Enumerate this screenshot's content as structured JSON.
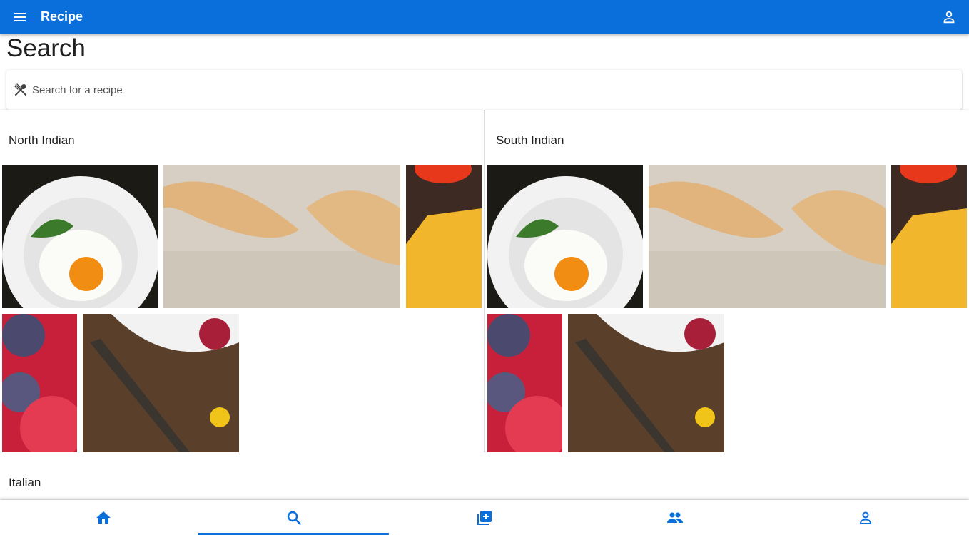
{
  "app": {
    "title": "Recipe",
    "accent_color": "#0a6fdb",
    "menu_icon": "menu-icon",
    "account_icon": "account-icon"
  },
  "page": {
    "title": "Search"
  },
  "search": {
    "placeholder": "Search for a recipe",
    "value": "",
    "icon": "utensils-icon"
  },
  "categories": [
    {
      "label": "North Indian",
      "images": [
        "fried-egg-plate",
        "dumplings-on-flour",
        "spaghetti-and-tomato",
        "raspberries-and-plums",
        "berry-bowl-with-spoon"
      ]
    },
    {
      "label": "South Indian",
      "images": [
        "fried-egg-plate",
        "dumplings-on-flour",
        "spaghetti-and-tomato",
        "raspberries-and-plums",
        "berry-bowl-with-spoon"
      ]
    },
    {
      "label": "Italian",
      "images": []
    }
  ],
  "bottom_nav": {
    "items": [
      {
        "name": "home",
        "icon": "home-icon",
        "active": false
      },
      {
        "name": "search",
        "icon": "search-icon",
        "active": true
      },
      {
        "name": "add",
        "icon": "add-box-icon",
        "active": false
      },
      {
        "name": "people",
        "icon": "people-icon",
        "active": false
      },
      {
        "name": "profile",
        "icon": "person-icon",
        "active": false
      }
    ]
  }
}
